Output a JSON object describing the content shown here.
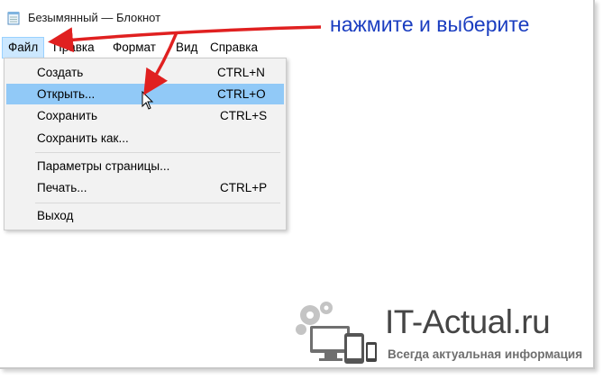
{
  "window": {
    "title": "Безымянный — Блокнот",
    "icon": "notepad-icon"
  },
  "menubar": {
    "items": [
      {
        "label": "Файл",
        "active": true
      },
      {
        "label": "Правка"
      },
      {
        "label": "Формат"
      },
      {
        "label": "Вид"
      },
      {
        "label": "Справка"
      }
    ]
  },
  "file_menu": {
    "items": [
      {
        "label": "Создать",
        "shortcut": "CTRL+N"
      },
      {
        "label": "Открыть...",
        "shortcut": "CTRL+O",
        "highlighted": true
      },
      {
        "label": "Сохранить",
        "shortcut": "CTRL+S"
      },
      {
        "label": "Сохранить как...",
        "shortcut": ""
      },
      {
        "label": "Параметры страницы...",
        "shortcut": ""
      },
      {
        "label": "Печать...",
        "shortcut": "CTRL+P"
      },
      {
        "label": "Выход",
        "shortcut": ""
      }
    ]
  },
  "annotation": {
    "text": "нажмите и выберите",
    "color": "#1a3dc0",
    "arrow_color": "#e02020"
  },
  "watermark": {
    "brand": "IT-Actual.ru",
    "tagline": "Всегда актуальная информация"
  },
  "colors": {
    "menu_highlight": "#91c9f7",
    "menubar_active": "#cce8ff"
  }
}
